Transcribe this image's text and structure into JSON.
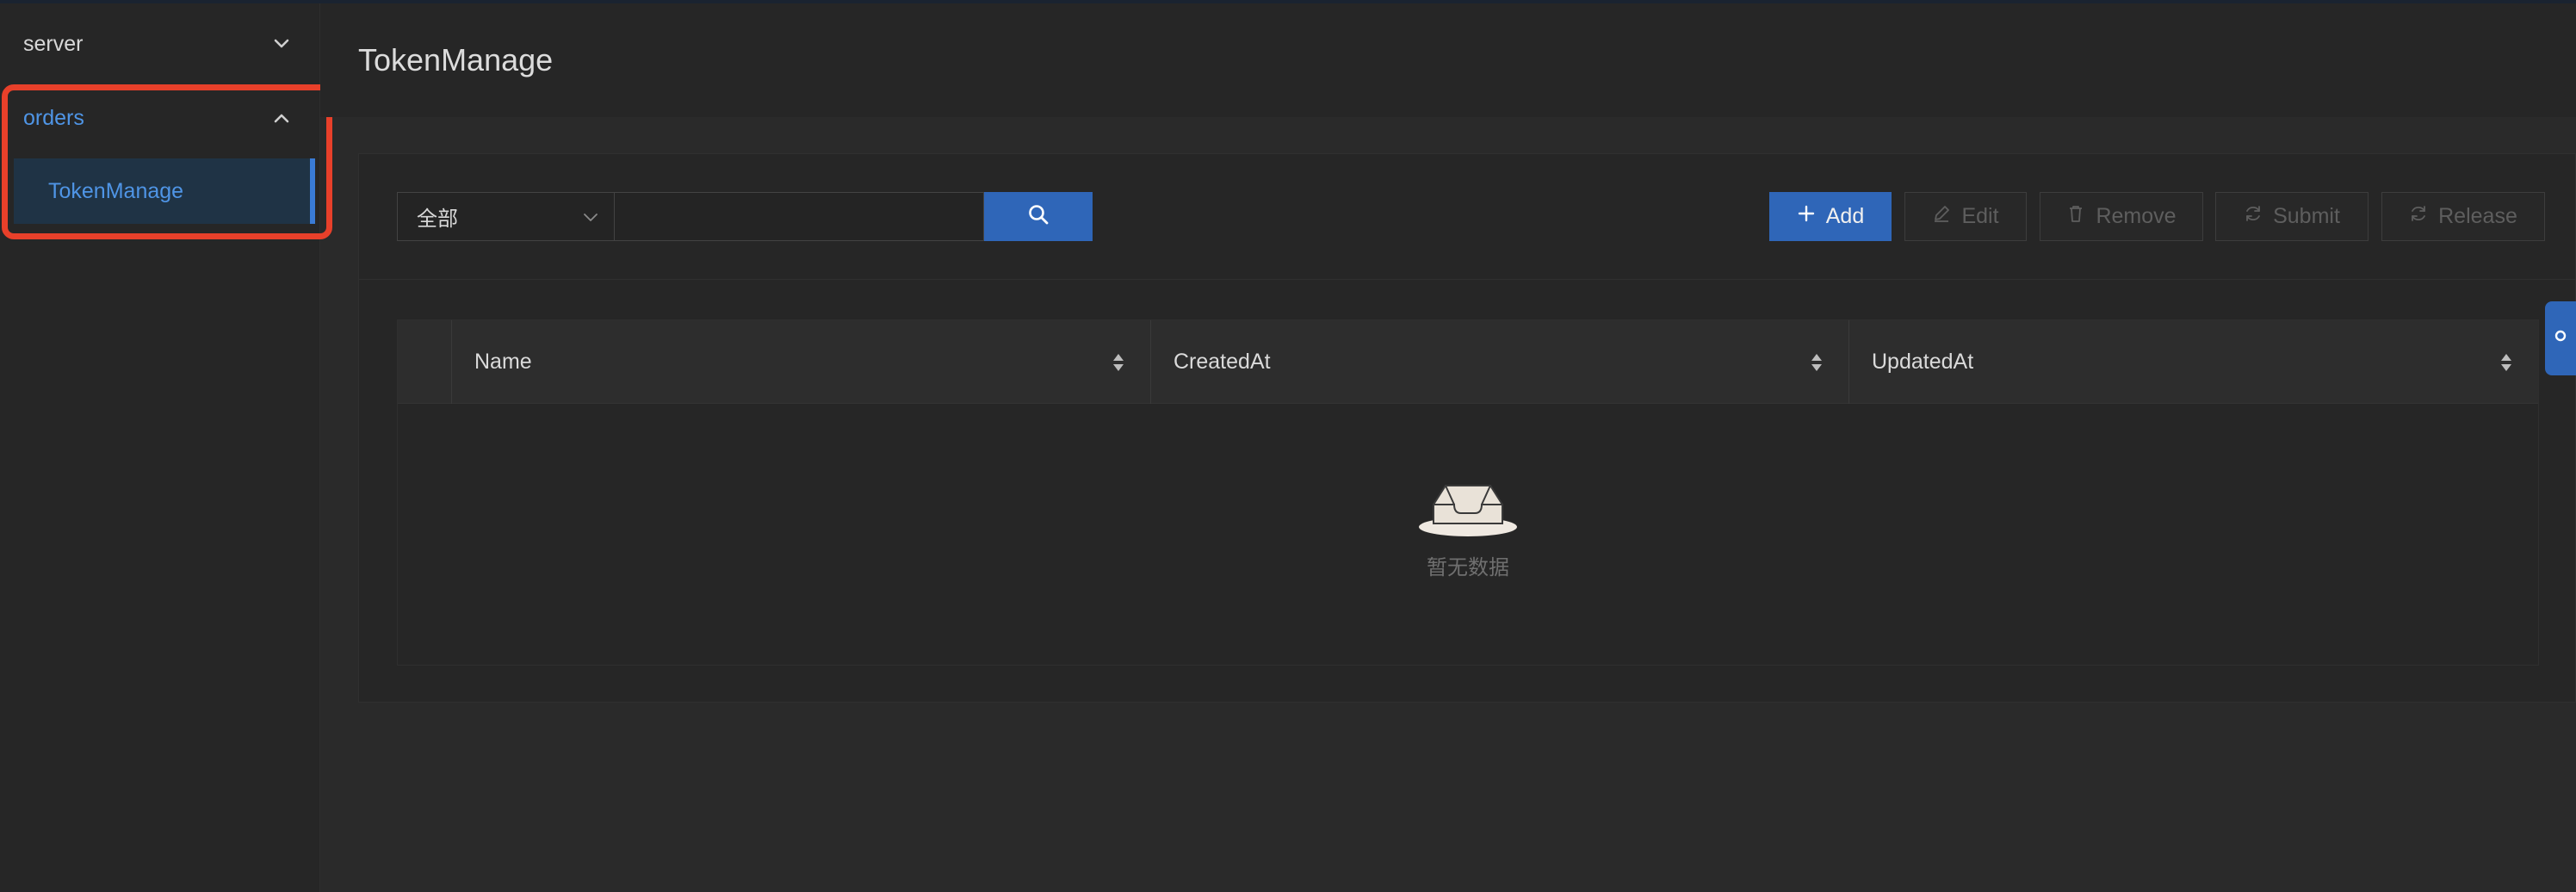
{
  "sidebar": {
    "groups": [
      {
        "label": "server",
        "expanded": false
      },
      {
        "label": "orders",
        "expanded": true,
        "items": [
          {
            "label": "TokenManage",
            "selected": true
          }
        ]
      }
    ]
  },
  "header": {
    "title": "TokenManage"
  },
  "toolbar": {
    "filter_select": {
      "value": "全部"
    },
    "search": {
      "value": "",
      "placeholder": ""
    },
    "buttons": {
      "add": "Add",
      "edit": "Edit",
      "remove": "Remove",
      "submit": "Submit",
      "release": "Release"
    }
  },
  "table": {
    "columns": [
      "Name",
      "CreatedAt",
      "UpdatedAt"
    ],
    "rows": [],
    "empty_text": "暂无数据"
  },
  "colors": {
    "accent": "#2f66b8",
    "menu_active": "#4f95e6",
    "highlight_box": "#e8402a"
  }
}
